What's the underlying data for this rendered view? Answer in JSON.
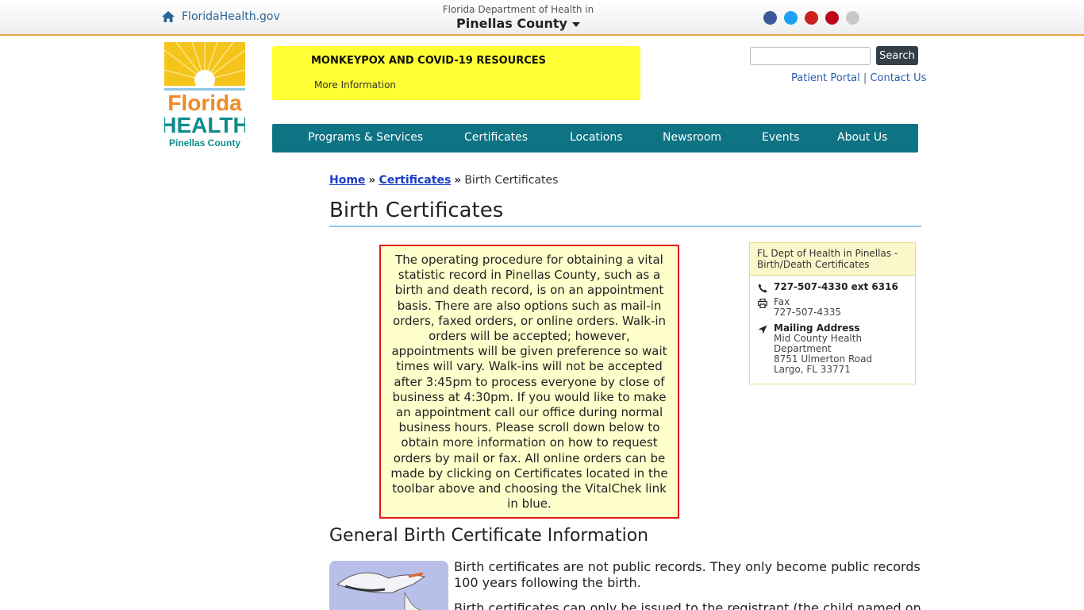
{
  "topbar": {
    "home_link": "FloridaHealth.gov",
    "dept_line1": "Florida Department of Health in",
    "dept_line2": "Pinellas County",
    "social_colors": [
      "#3b5998",
      "#1da1f2",
      "#cd201f",
      "#bd081c",
      "#c8c8c8"
    ]
  },
  "logo": {
    "word1": "Florida",
    "word2": "HEALTH",
    "word3": "Pinellas County"
  },
  "alert": {
    "title": "MONKEYPOX AND COVID-19 RESOURCES",
    "link": "More Information"
  },
  "search": {
    "placeholder": "",
    "button": "Search"
  },
  "util_links": {
    "patient_portal": "Patient Portal",
    "separator": "|",
    "contact_us": "Contact Us"
  },
  "nav": {
    "items": [
      "Programs & Services",
      "Certificates",
      "Locations",
      "Newsroom",
      "Events",
      "About Us"
    ]
  },
  "breadcrumb": {
    "home": "Home",
    "sep": "»",
    "certificates": "Certificates",
    "current": "Birth Certificates"
  },
  "page_title": "Birth Certificates",
  "notice": "The operating procedure for obtaining a vital statistic record in Pinellas County, such as a birth and death record, is on an appointment basis. There are also options such as mail-in orders, faxed orders, or online orders. Walk-in orders will be accepted; however, appointments will be given preference so wait times will vary. Walk-ins will not be accepted after 3:45pm to process everyone by close of business at 4:30pm. If you would like to make an appointment call our office during normal business hours. Please scroll down below to obtain more information on how to request orders by mail or fax. All online orders can be made by clicking on Certificates located in the toolbar above and choosing the VitalChek link in blue.",
  "contact": {
    "heading": "FL Dept of Health in Pinellas - Birth/Death Certificates",
    "phone": "727-507-4330 ext 6316",
    "fax_label": "Fax",
    "fax": "727-507-4335",
    "mail_label": "Mailing Address",
    "mail_line1": "Mid County Health",
    "mail_line2": "Department",
    "mail_line3": "8751 Ulmerton Road",
    "mail_line4": "Largo, FL 33771"
  },
  "section_title": "General Birth Certificate Information",
  "paragraphs": {
    "p1": "Birth certificates are not public records. They only become public records 100 years following the birth.",
    "p2": "Birth certificates can only be issued to the registrant (the child named on the"
  },
  "colors": {
    "nav": "#0e7383",
    "alert": "#ffff33",
    "notice_border": "#e01b1b",
    "notice_bg": "#ffffcc",
    "accent_orange": "#e8a33d"
  }
}
